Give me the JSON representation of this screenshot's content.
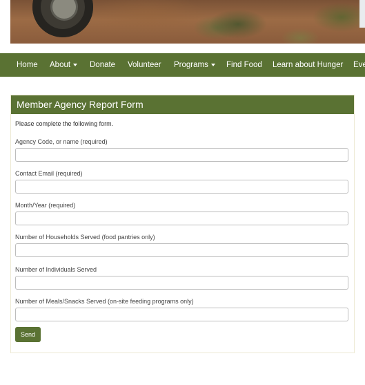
{
  "nav": {
    "items": [
      {
        "label": "Home"
      },
      {
        "label": "About"
      },
      {
        "label": "Donate"
      },
      {
        "label": "Volunteer"
      },
      {
        "label": "Programs"
      },
      {
        "label": "Find Food"
      },
      {
        "label": "Learn about Hunger"
      },
      {
        "label": "Eve"
      }
    ]
  },
  "form": {
    "title": "Member Agency Report Form",
    "intro": "Please complete the following form.",
    "fields": [
      {
        "label": "Agency Code, or name (required)",
        "value": ""
      },
      {
        "label": "Contact Email (required)",
        "value": ""
      },
      {
        "label": "Month/Year (required)",
        "value": ""
      },
      {
        "label": "Number of Households Served (food pantries only)",
        "value": ""
      },
      {
        "label": "Number of Individuals Served",
        "value": ""
      },
      {
        "label": "Number of Meals/Snacks Served (on-site feeding programs only)",
        "value": ""
      }
    ],
    "submit_label": "Send"
  },
  "colors": {
    "brand_green": "#5a7233",
    "panel_border": "#ede9d4"
  }
}
